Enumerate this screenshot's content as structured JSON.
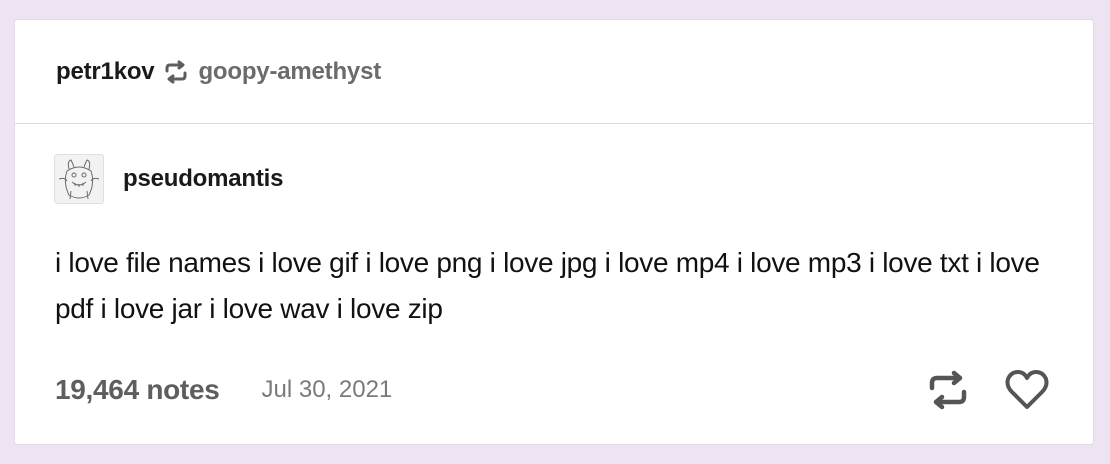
{
  "post": {
    "reblogger": "petr1kov",
    "reblogged_from": "goopy-amethyst",
    "original_poster": "pseudomantis",
    "body": "i love file names i love gif i love png i love jpg i love mp4 i love mp3 i love txt i love pdf i love jar i love wav i love zip",
    "notes_label": "19,464 notes",
    "date": "Jul 30, 2021"
  },
  "icons": {
    "header_reblog": "reblog-icon",
    "avatar": "monster-sketch-avatar",
    "reblog_action": "reblog-icon",
    "like_action": "heart-icon"
  },
  "colors": {
    "background": "#ede3f3",
    "card": "#ffffff",
    "text": "#1a1a1a",
    "muted": "#6b6b6b"
  }
}
